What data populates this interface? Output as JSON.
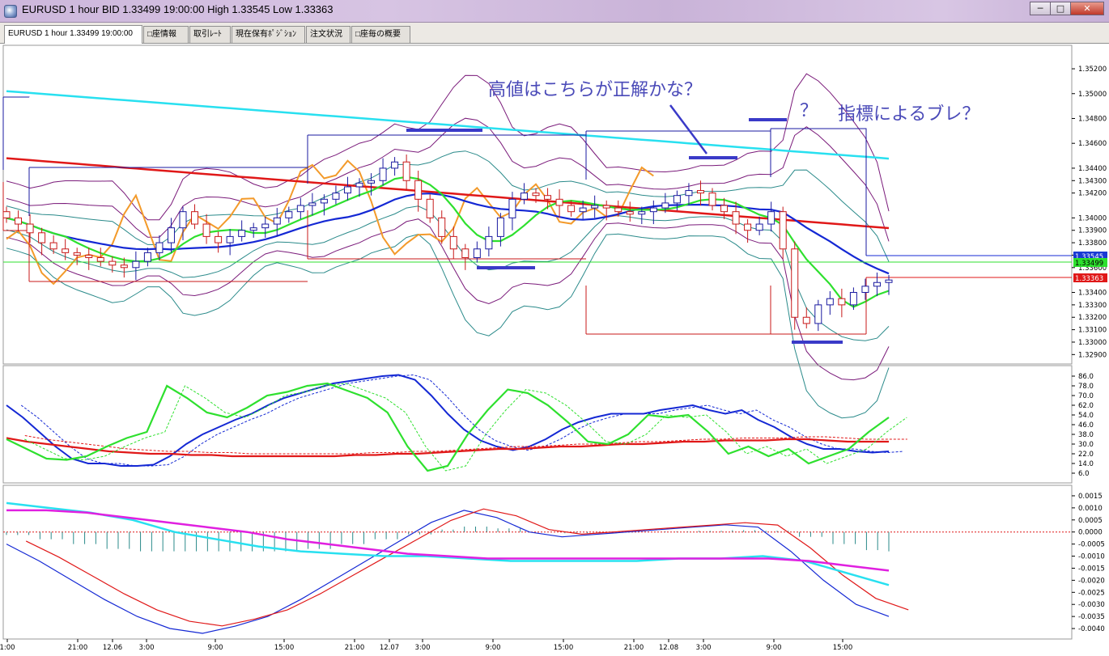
{
  "window": {
    "title": "EURUSD 1 hour BID 1.33499 19:00:00 High 1.33545 Low 1.33363",
    "buttons": {
      "minimize": "─",
      "maximize": "□",
      "close": "✕"
    }
  },
  "tabs": [
    {
      "label": "EURUSD 1 hour 1.33499 19:00:00",
      "active": true
    },
    {
      "label": "□座情報",
      "active": false
    },
    {
      "label": "取引ﾚｰﾄ",
      "active": false
    },
    {
      "label": "現在保有ﾎﾟｼﾞｼｮﾝ",
      "active": false
    },
    {
      "label": "注文状況",
      "active": false
    },
    {
      "label": "□座毎の概要",
      "active": false
    }
  ],
  "annotations": {
    "main_note": "高値はこちらが正解かな？",
    "question": "？",
    "indicator_note": "指標によるブレ？"
  },
  "price_labels": {
    "blue": "1.33545",
    "green": "1.33499",
    "red": "1.33363"
  },
  "colors": {
    "candle_up": "#1a1aa0",
    "candle_down": "#c81a1a",
    "orange": "#f39a2a",
    "green": "#2ee02e",
    "red": "#e01818",
    "blue": "#1428d4",
    "cyan": "#28e0f0",
    "purple": "#7a1a7a",
    "teal": "#2a8a8a",
    "magenta": "#e020e0",
    "annotation": "#3a3ac8"
  },
  "chart_data": [
    {
      "type": "candlestick",
      "title": "",
      "y_ticks": [
        "1.35200",
        "1.35000",
        "1.34800",
        "1.34600",
        "1.34400",
        "1.34300",
        "1.34200",
        "1.34000",
        "1.33900",
        "1.33800",
        "1.33700",
        "1.33600",
        "1.33400",
        "1.33300",
        "1.33200",
        "1.33100",
        "1.33000",
        "1.32900"
      ],
      "ylim": [
        1.3285,
        1.3535
      ],
      "x_ticks": [
        "1:00",
        "21:00",
        "12.06",
        "3:00",
        "9:00",
        "15:00",
        "21:00",
        "12.07",
        "3:00",
        "9:00",
        "15:00",
        "21:00",
        "12.08",
        "3:00",
        "9:00",
        "15:00"
      ],
      "close_series": [
        1.34,
        1.3395,
        1.3388,
        1.338,
        1.3375,
        1.3372,
        1.337,
        1.3368,
        1.3365,
        1.3362,
        1.336,
        1.3365,
        1.3372,
        1.338,
        1.3392,
        1.3405,
        1.3395,
        1.3385,
        1.338,
        1.3385,
        1.339,
        1.3392,
        1.3395,
        1.34,
        1.3405,
        1.341,
        1.3412,
        1.3415,
        1.342,
        1.3425,
        1.3428,
        1.343,
        1.344,
        1.3445,
        1.343,
        1.3415,
        1.34,
        1.3385,
        1.3375,
        1.3368,
        1.3375,
        1.3385,
        1.34,
        1.3415,
        1.342,
        1.3418,
        1.3415,
        1.341,
        1.3405,
        1.3408,
        1.341,
        1.3408,
        1.3405,
        1.3403,
        1.3405,
        1.3408,
        1.3412,
        1.3418,
        1.3422,
        1.342,
        1.341,
        1.3405,
        1.3395,
        1.339,
        1.3395,
        1.3405,
        1.3375,
        1.332,
        1.3315,
        1.333,
        1.3335,
        1.333,
        1.334,
        1.3345,
        1.3348,
        1.335
      ]
    },
    {
      "type": "line",
      "title": "",
      "y_ticks": [
        "86.0",
        "78.0",
        "70.0",
        "62.0",
        "54.0",
        "46.0",
        "38.0",
        "30.0",
        "22.0",
        "14.0",
        "6.0"
      ],
      "ylim": [
        0,
        92
      ],
      "series": [
        {
          "values": [
            62,
            52,
            40,
            28,
            18,
            14,
            14,
            12,
            12,
            13,
            20,
            30,
            38,
            44,
            50,
            55,
            62,
            68,
            72,
            76,
            80,
            82,
            84,
            86,
            87,
            83,
            70,
            55,
            42,
            33,
            28,
            25,
            28,
            34,
            42,
            48,
            52,
            55,
            55,
            55,
            58,
            60,
            62,
            58,
            55,
            58,
            50,
            44,
            36,
            30,
            26,
            26,
            24,
            23,
            24
          ]
        },
        {
          "values": [
            35,
            32,
            30,
            28,
            26,
            24,
            23,
            22,
            22,
            21,
            21,
            20,
            20,
            20,
            20,
            20,
            20,
            21,
            21,
            22,
            22,
            23,
            24,
            25,
            26,
            26,
            27,
            28,
            28,
            29,
            30,
            30,
            31,
            32,
            32,
            33,
            33,
            33,
            34,
            34,
            33,
            32,
            32,
            32
          ]
        },
        {
          "values": [
            34,
            26,
            18,
            17,
            20,
            28,
            35,
            40,
            78,
            68,
            56,
            52,
            60,
            70,
            73,
            78,
            80,
            74,
            68,
            56,
            28,
            8,
            12,
            38,
            58,
            75,
            72,
            62,
            48,
            32,
            30,
            38,
            54,
            52,
            54,
            40,
            22,
            28,
            20,
            26,
            14,
            20,
            26,
            40,
            52
          ]
        }
      ]
    },
    {
      "type": "line",
      "title": "",
      "y_ticks": [
        "0.0015",
        "0.0010",
        "0.0005",
        "0.0000",
        "-0.0005",
        "-0.0010",
        "-0.0015",
        "-0.0020",
        "-0.0025",
        "-0.0030",
        "-0.0035",
        "-0.0040"
      ],
      "ylim": [
        -0.0043,
        0.0018
      ],
      "series": [
        {
          "values": [
            -0.0005,
            -0.0012,
            -0.002,
            -0.0028,
            -0.0035,
            -0.004,
            -0.0042,
            -0.0039,
            -0.0035,
            -0.0028,
            -0.002,
            -0.0012,
            -0.0004,
            0.0004,
            0.0009,
            0.0006,
            0.0,
            -0.0002,
            -0.0001,
            0.0,
            0.0001,
            0.0002,
            0.0003,
            0.0002,
            -0.0008,
            -0.002,
            -0.003,
            -0.0035
          ]
        },
        {
          "values": [
            0.0012,
            0.001,
            0.0008,
            0.0005,
            0.0,
            -0.0003,
            -0.0006,
            -0.0008,
            -0.0009,
            -0.001,
            -0.001,
            -0.0011,
            -0.0012,
            -0.0012,
            -0.0012,
            -0.0012,
            -0.0011,
            -0.0011,
            -0.001,
            -0.0012,
            -0.0017,
            -0.0022
          ]
        },
        {
          "values": [
            0.0009,
            0.0009,
            0.0008,
            0.0006,
            0.0004,
            0.0002,
            0.0,
            -0.0003,
            -0.0005,
            -0.0007,
            -0.0009,
            -0.001,
            -0.0011,
            -0.0011,
            -0.0011,
            -0.0011,
            -0.0011,
            -0.0011,
            -0.0011,
            -0.0011,
            -0.0012,
            -0.0014,
            -0.0016
          ]
        }
      ]
    }
  ]
}
